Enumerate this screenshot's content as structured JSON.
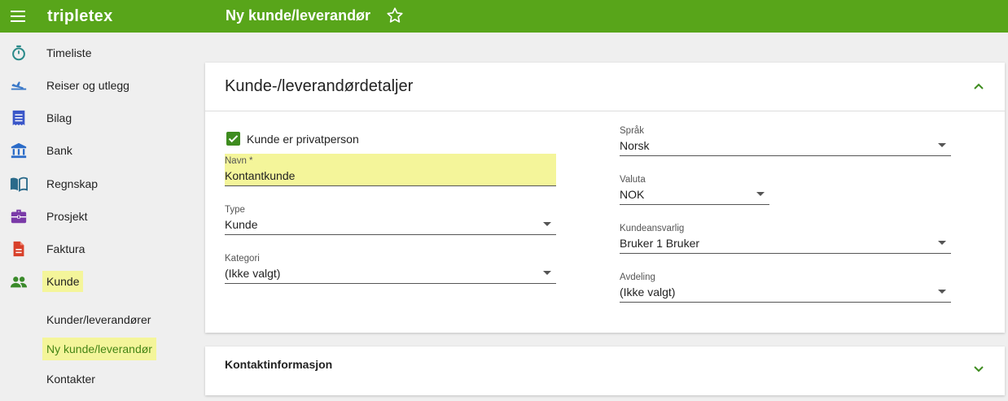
{
  "header": {
    "brand": "tripletex",
    "page_title": "Ny kunde/leverandør"
  },
  "sidebar": {
    "items": [
      {
        "label": "Timeliste",
        "icon": "stopwatch-icon",
        "color": "#2a8a8a"
      },
      {
        "label": "Reiser og utlegg",
        "icon": "airplane-icon",
        "color": "#3a78c8"
      },
      {
        "label": "Bilag",
        "icon": "receipt-icon",
        "color": "#3a56c8"
      },
      {
        "label": "Bank",
        "icon": "bank-icon",
        "color": "#2a6bc8"
      },
      {
        "label": "Regnskap",
        "icon": "book-icon",
        "color": "#2a6a8a"
      },
      {
        "label": "Prosjekt",
        "icon": "briefcase-icon",
        "color": "#7a3aa8"
      },
      {
        "label": "Faktura",
        "icon": "document-icon",
        "color": "#d8402a"
      },
      {
        "label": "Kunde",
        "icon": "people-icon",
        "color": "#3a8a2a"
      }
    ],
    "subitems": [
      {
        "label": "Kunder/leverandører"
      },
      {
        "label": "Ny kunde/leverandør"
      },
      {
        "label": "Kontakter"
      }
    ]
  },
  "details": {
    "title": "Kunde-/leverandørdetaljer",
    "private_person": {
      "label": "Kunde er privatperson",
      "checked": true
    },
    "name": {
      "label": "Navn *",
      "value": "Kontantkunde"
    },
    "type": {
      "label": "Type",
      "value": "Kunde"
    },
    "category": {
      "label": "Kategori",
      "value": "(Ikke valgt)"
    },
    "language": {
      "label": "Språk",
      "value": "Norsk"
    },
    "currency": {
      "label": "Valuta",
      "value": "NOK"
    },
    "account_manager": {
      "label": "Kundeansvarlig",
      "value": "Bruker 1 Bruker"
    },
    "department": {
      "label": "Avdeling",
      "value": "(Ikke valgt)"
    }
  },
  "contact": {
    "title": "Kontaktinformasjon"
  },
  "colors": {
    "brand_green": "#58a51a",
    "highlight": "#f4f59a",
    "checkbox_green": "#3e8c1f"
  }
}
